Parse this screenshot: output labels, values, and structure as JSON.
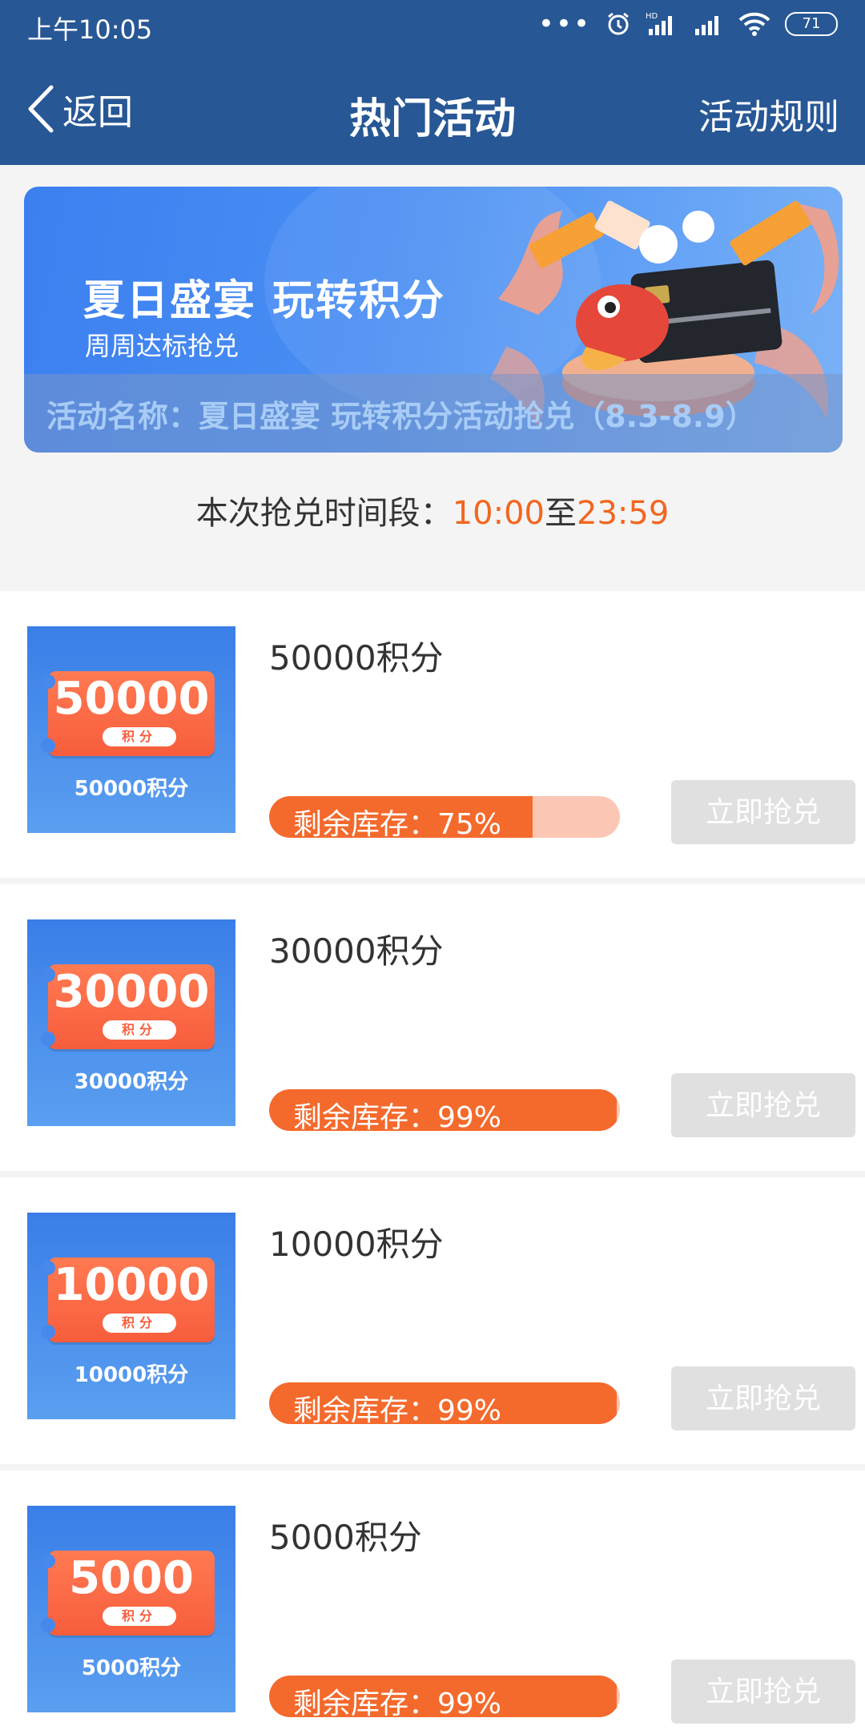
{
  "status_bar": {
    "time": "上午10:05",
    "battery": "71"
  },
  "nav": {
    "back_label": "返回",
    "title": "热门活动",
    "rules_label": "活动规则"
  },
  "banner": {
    "title": "夏日盛宴 玩转积分",
    "subtitle": "周周达标抢兑",
    "activity_name": "活动名称：夏日盛宴 玩转积分活动抢兑（8.3-8.9）"
  },
  "time_segment": {
    "label": "本次抢兑时间段：",
    "start": "10:00",
    "separator": "至",
    "end": "23:59"
  },
  "items": [
    {
      "title": "50000积分",
      "ticket_value": "50000",
      "ticket_unit": "积分",
      "caption": "50000积分",
      "stock_label": "剩余库存：75%",
      "stock_percent": 75,
      "button_label": "立即抢兑"
    },
    {
      "title": "30000积分",
      "ticket_value": "30000",
      "ticket_unit": "积分",
      "caption": "30000积分",
      "stock_label": "剩余库存：99%",
      "stock_percent": 99,
      "button_label": "立即抢兑"
    },
    {
      "title": "10000积分",
      "ticket_value": "10000",
      "ticket_unit": "积分",
      "caption": "10000积分",
      "stock_label": "剩余库存：99%",
      "stock_percent": 99,
      "button_label": "立即抢兑"
    },
    {
      "title": "5000积分",
      "ticket_value": "5000",
      "ticket_unit": "积分",
      "caption": "5000积分",
      "stock_label": "剩余库存：99%",
      "stock_percent": 99,
      "button_label": "立即抢兑"
    }
  ],
  "colors": {
    "header": "#275795",
    "accent_orange": "#f2661f",
    "button_disabled": "#e0e0e0"
  }
}
